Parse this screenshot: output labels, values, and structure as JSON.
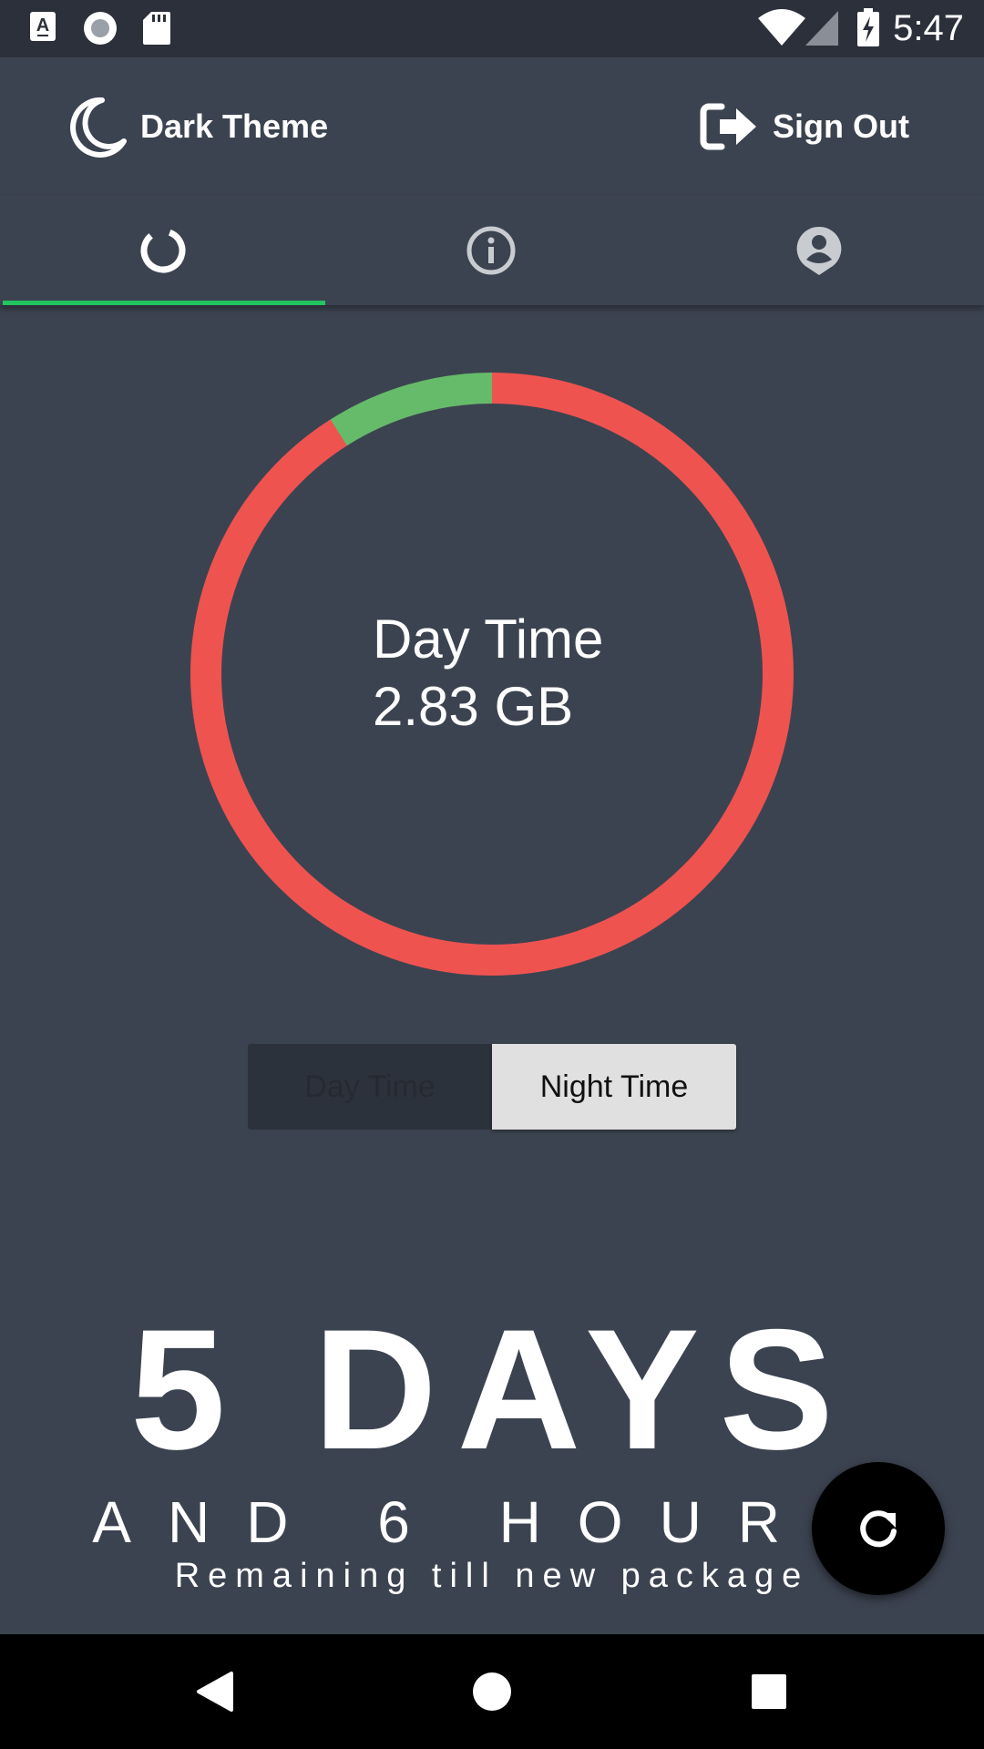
{
  "status_bar": {
    "time": "5:47",
    "left_icons": [
      "notification-a-icon",
      "circle-record-icon",
      "sd-card-icon"
    ],
    "right_icons": [
      "wifi-icon",
      "cell-signal-icon",
      "battery-charging-icon"
    ]
  },
  "header": {
    "theme_label": "Dark Theme",
    "signout_label": "Sign Out"
  },
  "tabs": [
    {
      "icon": "usage-ring-icon",
      "active": true
    },
    {
      "icon": "info-icon",
      "active": false
    },
    {
      "icon": "profile-icon",
      "active": false
    }
  ],
  "usage": {
    "label": "Day Time",
    "value": "2.83 GB",
    "used_fraction": 0.91,
    "remaining_fraction": 0.09,
    "used_color": "#ef5350",
    "remaining_color": "#66bb6a"
  },
  "toggle": {
    "day_label": "Day Time",
    "night_label": "Night Time",
    "selected": "Night Time"
  },
  "countdown": {
    "days": "5 DAYS",
    "hours": "AND 6 HOURS",
    "caption": "Remaining till new package"
  },
  "colors": {
    "background": "#3c4350",
    "accent": "#22c55e"
  }
}
